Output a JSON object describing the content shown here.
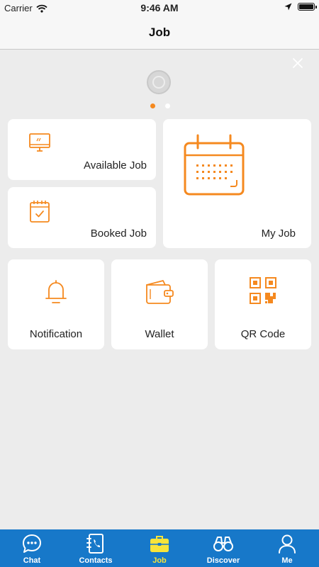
{
  "status_bar": {
    "carrier": "Carrier",
    "time": "9:46 AM"
  },
  "nav": {
    "title": "Job"
  },
  "banner": {
    "slides_total": 2,
    "active_slide": 1
  },
  "tiles": {
    "available_job": {
      "label": "Available Job",
      "icon": "monitor-icon"
    },
    "booked_job": {
      "label": "Booked Job",
      "icon": "calendar-check-icon"
    },
    "my_job": {
      "label": "My Job",
      "icon": "calendar-icon"
    },
    "notification": {
      "label": "Notification",
      "icon": "bell-icon"
    },
    "wallet": {
      "label": "Wallet",
      "icon": "wallet-icon"
    },
    "qr_code": {
      "label": "QR Code",
      "icon": "qr-code-icon"
    }
  },
  "tab_bar": {
    "items": [
      {
        "label": "Chat",
        "icon": "chat-icon"
      },
      {
        "label": "Contacts",
        "icon": "contacts-icon"
      },
      {
        "label": "Job",
        "icon": "briefcase-icon",
        "active": true
      },
      {
        "label": "Discover",
        "icon": "binoculars-icon"
      },
      {
        "label": "Me",
        "icon": "person-icon"
      }
    ]
  },
  "colors": {
    "accent": "#f5891f",
    "tab_bar": "#1778c9",
    "tab_active": "#f7e43a",
    "background": "#ececec"
  }
}
